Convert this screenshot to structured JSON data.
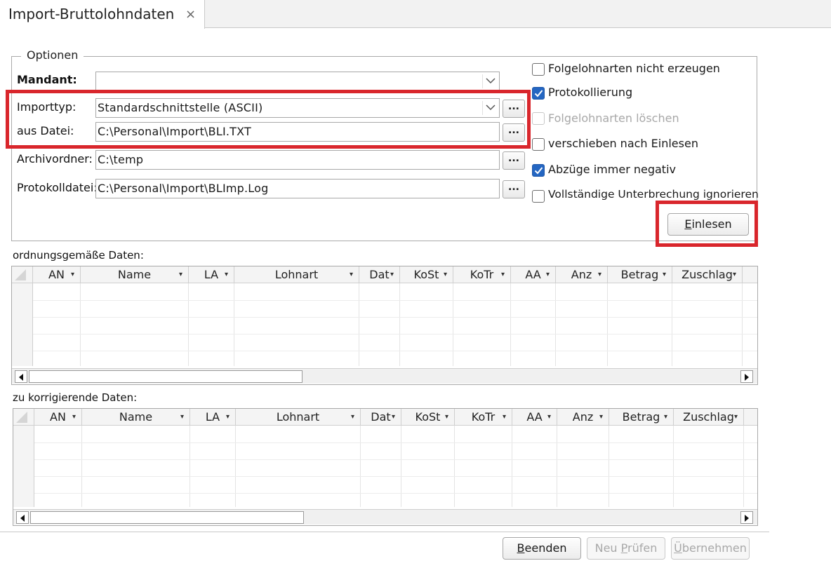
{
  "tab": {
    "title": "Import-Bruttolohndaten",
    "close_glyph": "×"
  },
  "options": {
    "legend": "Optionen",
    "mandant": {
      "label": "Mandant:",
      "value": ""
    },
    "importtyp": {
      "label": "Importtyp:",
      "value": "Standardschnittstelle (ASCII)"
    },
    "aus_datei": {
      "label": "aus Datei:",
      "value": "C:\\Personal\\Import\\BLI.TXT"
    },
    "archivordner": {
      "label": "Archivordner:",
      "value": "C:\\temp"
    },
    "protokolldatei": {
      "label": "Protokolldatei:",
      "value": "C:\\Personal\\Import\\BLImp.Log"
    },
    "browse_label": "...",
    "checkboxes": [
      {
        "label": "Folgelohnarten nicht erzeugen",
        "checked": false,
        "disabled": false
      },
      {
        "label": "Protokollierung",
        "checked": true,
        "disabled": false
      },
      {
        "label": "Folgelohnarten löschen",
        "checked": false,
        "disabled": true
      },
      {
        "label": "verschieben nach Einlesen",
        "checked": false,
        "disabled": false
      },
      {
        "label": "Abzüge immer negativ",
        "checked": true,
        "disabled": false
      },
      {
        "label": "Vollständige Unterbrechung ignorieren",
        "checked": false,
        "disabled": false
      }
    ],
    "einlesen": {
      "mnemonic": "E",
      "rest": "inlesen"
    }
  },
  "grid1": {
    "title": "ordnungsgemäße Daten:"
  },
  "grid2": {
    "title": "zu korrigierende Daten:"
  },
  "columns": [
    "AN",
    "Name",
    "LA",
    "Lohnart",
    "Dat",
    "KoSt",
    "KoTr",
    "AA",
    "Anz",
    "Betrag",
    "Zuschlag"
  ],
  "footer": {
    "beenden": {
      "mnemonic": "B",
      "rest": "eenden"
    },
    "neu_pruefen": {
      "pre": "Neu ",
      "mnemonic": "P",
      "rest": "rüfen"
    },
    "uebernehmen": {
      "mnemonic": "Ü",
      "rest": "bernehmen"
    }
  },
  "colors": {
    "highlight": "#d9262c",
    "checkbox_checked": "#2466c2"
  }
}
